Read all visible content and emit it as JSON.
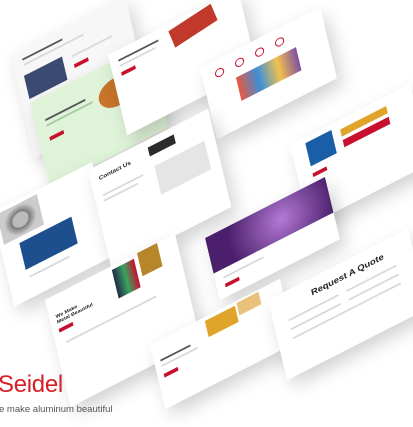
{
  "brand": {
    "name": "Seidel",
    "tagline": "e make aluminum beautiful",
    "accent_color": "#d71f26"
  },
  "mockups": {
    "contact_title": "Contact Us",
    "quote_title": "Request A Quote",
    "hero_title_line1": "We Make",
    "hero_title_line2": "Metal Beautiful"
  }
}
